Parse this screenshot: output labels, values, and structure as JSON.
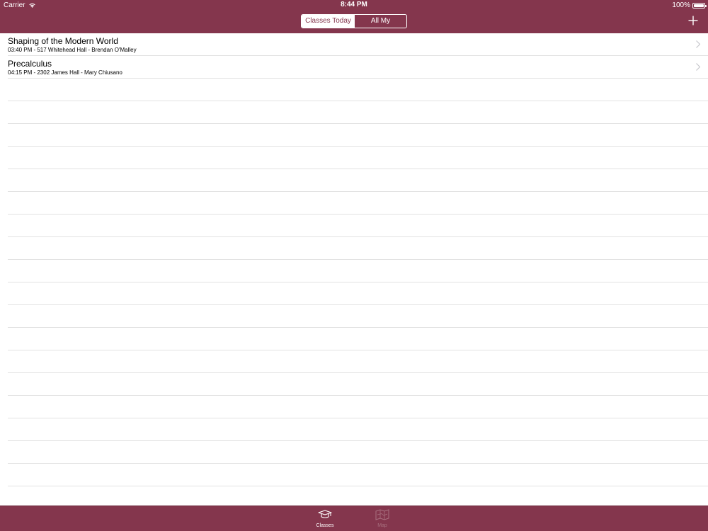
{
  "colors": {
    "accent": "#84364d",
    "tab_inactive": "#a8707f",
    "separator": "#e2e2e2"
  },
  "status_bar": {
    "carrier": "Carrier",
    "time": "8:44 PM",
    "battery": "100%"
  },
  "nav": {
    "segments": [
      {
        "label": "Classes Today",
        "selected": true
      },
      {
        "label": "All My Classes",
        "selected": false
      }
    ],
    "add_icon": "plus-icon"
  },
  "classes": [
    {
      "title": "Shaping of the Modern World",
      "subtitle": "03:40 PM - 517 Whitehead Hall - Brendan O'Malley"
    },
    {
      "title": "Precalculus",
      "subtitle": "04:15 PM - 2302 James Hall - Mary Chiusano"
    }
  ],
  "tab_bar": {
    "tabs": [
      {
        "label": "Classes",
        "icon": "graduation-cap-icon",
        "selected": true
      },
      {
        "label": "Map",
        "icon": "map-icon",
        "selected": false
      }
    ]
  }
}
